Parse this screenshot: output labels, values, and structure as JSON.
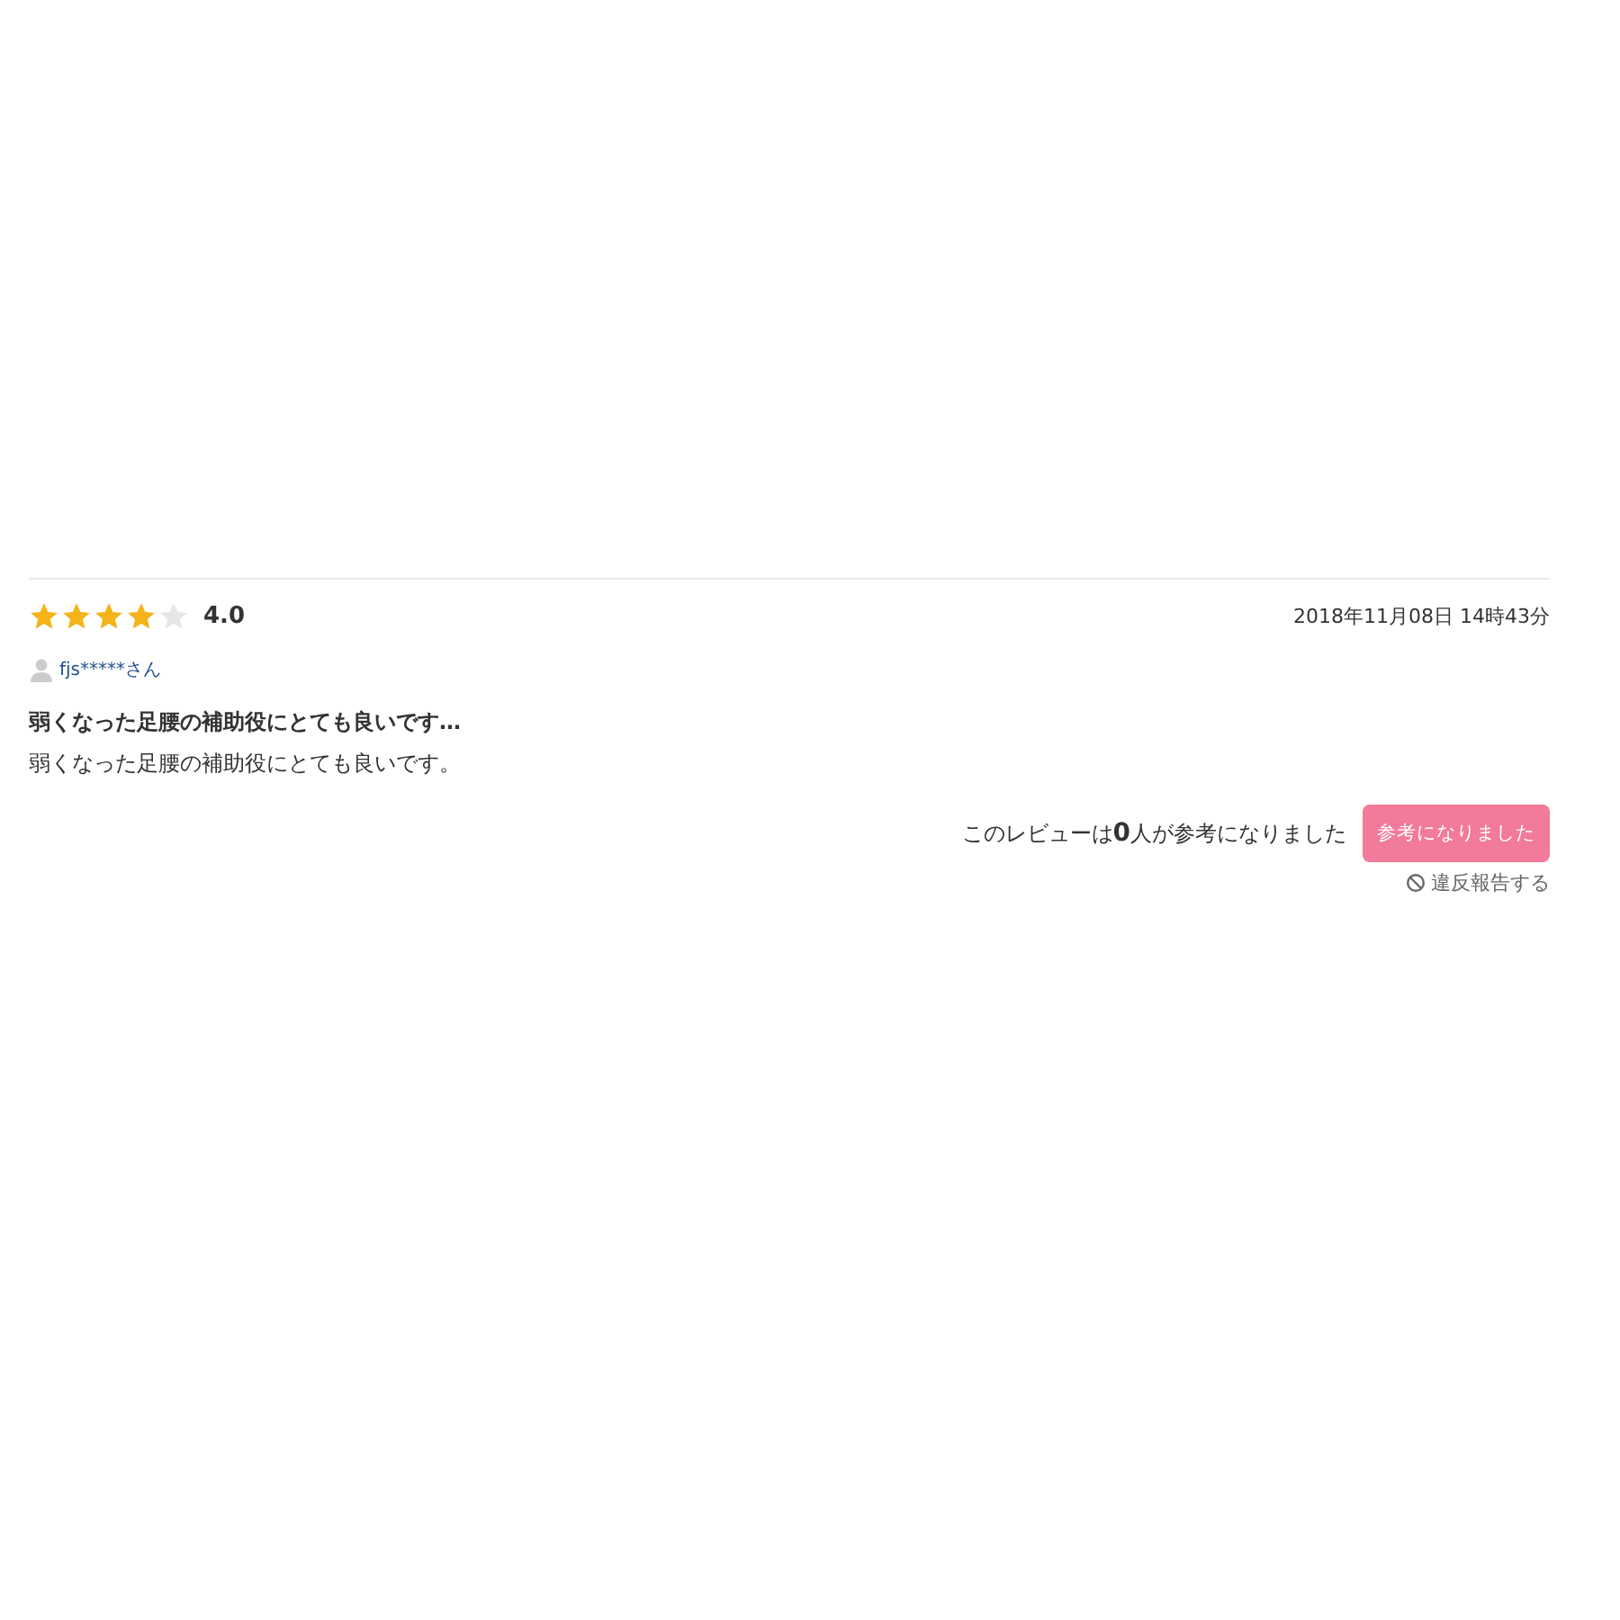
{
  "review": {
    "stars": 4,
    "rating": "4.0",
    "date": "2018年11月08日 14時43分",
    "reviewer": "fjs*****さん",
    "title": "弱くなった足腰の補助役にとても良いです…",
    "body": "弱くなった足腰の補助役にとても良いです。",
    "helpful_count_text": "このレビューは**0**人が参考になりました",
    "helpful_button": "参考になりました",
    "report_link": "違反報告する"
  }
}
